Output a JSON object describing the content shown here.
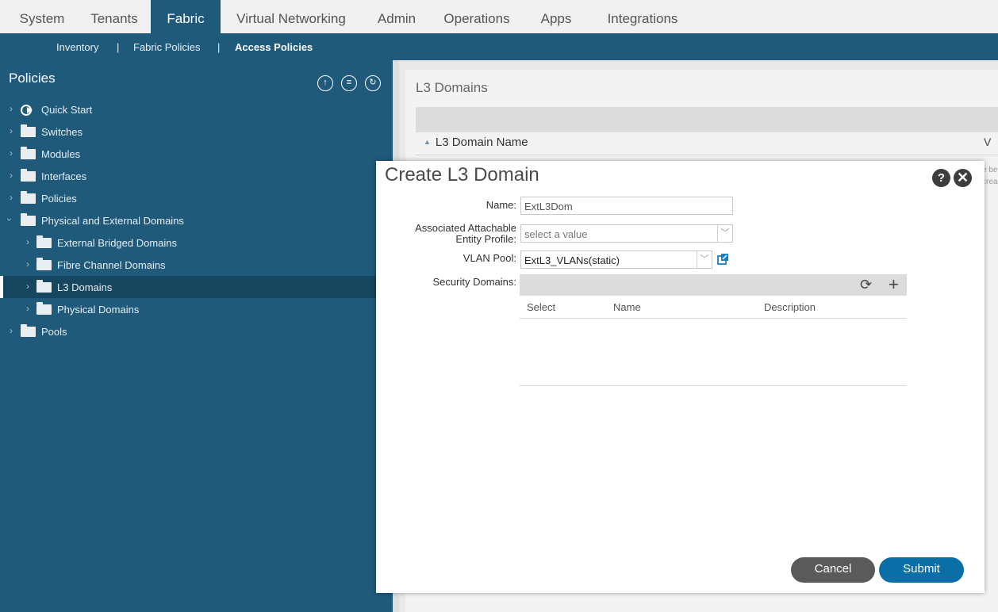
{
  "top_nav": [
    "System",
    "Tenants",
    "Fabric",
    "Virtual Networking",
    "Admin",
    "Operations",
    "Apps",
    "Integrations"
  ],
  "sub_nav": {
    "inventory": "Inventory",
    "sep1": "|",
    "fabric_policies": "Fabric Policies",
    "sep2": "|",
    "access_policies": "Access Policies"
  },
  "sidebar": {
    "title": "Policies",
    "items": [
      {
        "label": "Quick Start"
      },
      {
        "label": "Switches"
      },
      {
        "label": "Modules"
      },
      {
        "label": "Interfaces"
      },
      {
        "label": "Policies"
      },
      {
        "label": "Physical and External Domains"
      },
      {
        "label": "External Bridged Domains"
      },
      {
        "label": "Fibre Channel Domains"
      },
      {
        "label": "L3 Domains"
      },
      {
        "label": "Physical Domains"
      },
      {
        "label": "Pools"
      }
    ]
  },
  "content": {
    "heading": "L3 Domains",
    "column_name": "L3 Domain Name",
    "col2_fragment": "V",
    "frag1": "e be",
    "frag2": "crea"
  },
  "modal": {
    "title": "Create L3 Domain",
    "help": "?",
    "close": "✕",
    "name_label": "Name:",
    "name_value": "ExtL3Dom",
    "aaep_label_line1": "Associated Attachable",
    "aaep_label_line2": "Entity Profile:",
    "aaep_placeholder": "select a value",
    "vlan_label": "VLAN Pool:",
    "vlan_value": "ExtL3_VLANs(static)",
    "security_label": "Security Domains:",
    "security_columns": [
      "Select",
      "Name",
      "Description"
    ],
    "cancel": "Cancel",
    "submit": "Submit"
  },
  "colors": {
    "nav_active": "#1f5a7a",
    "sidebar": "#1f5a7a",
    "submit": "#0b6fa7",
    "cancel": "#5a5a5a"
  },
  "icons": [
    "refresh-icon",
    "add-icon",
    "close-icon",
    "help-icon",
    "external-link-icon",
    "folder-icon",
    "quick-start-icon"
  ]
}
